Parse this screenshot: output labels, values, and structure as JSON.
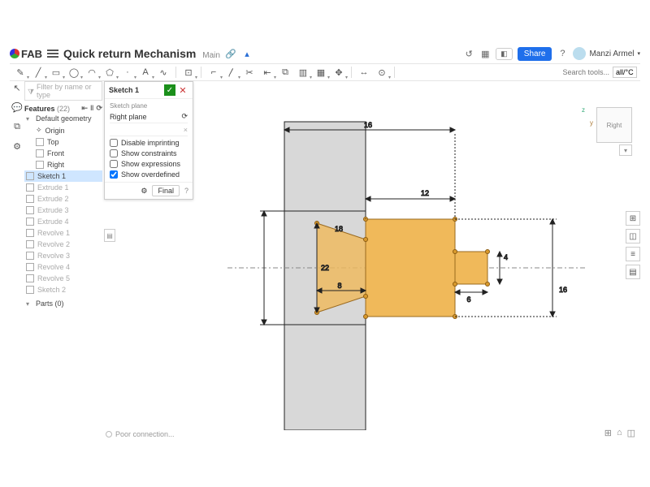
{
  "app": {
    "logo_text": "FAB"
  },
  "doc": {
    "title": "Quick return Mechanism",
    "branch": "Main"
  },
  "topbar": {
    "share": "Share",
    "user": "Manzi Armel"
  },
  "toolbar": {
    "search_label": "Search tools...",
    "unit_field": "all/°C"
  },
  "tree": {
    "filter_placeholder": "Filter by name or type",
    "heading": "Features",
    "count": "(22)",
    "default_geom": "Default geometry",
    "origin": "Origin",
    "planes": [
      "Top",
      "Front",
      "Right"
    ],
    "items": [
      "Sketch 1",
      "Extrude 1",
      "Extrude 2",
      "Extrude 3",
      "Extrude 4",
      "Revolve 1",
      "Revolve 2",
      "Revolve 3",
      "Revolve 4",
      "Revolve 5",
      "Sketch 2"
    ],
    "parts": "Parts (0)"
  },
  "sketchpanel": {
    "title": "Sketch 1",
    "plane_label": "Sketch plane",
    "plane_value": "Right plane",
    "opts": {
      "imprint": "Disable imprinting",
      "constraints": "Show constraints",
      "expressions": "Show expressions",
      "overdefined": "Show overdefined"
    },
    "final": "Final"
  },
  "viewcube": {
    "face": "Right"
  },
  "dims": {
    "top": "16",
    "upper": "12",
    "rightH": "16",
    "small4": "4",
    "small6": "6",
    "mid8": "8",
    "q2": "22",
    "tiny": "18"
  },
  "status": {
    "msg": "Poor connection..."
  }
}
